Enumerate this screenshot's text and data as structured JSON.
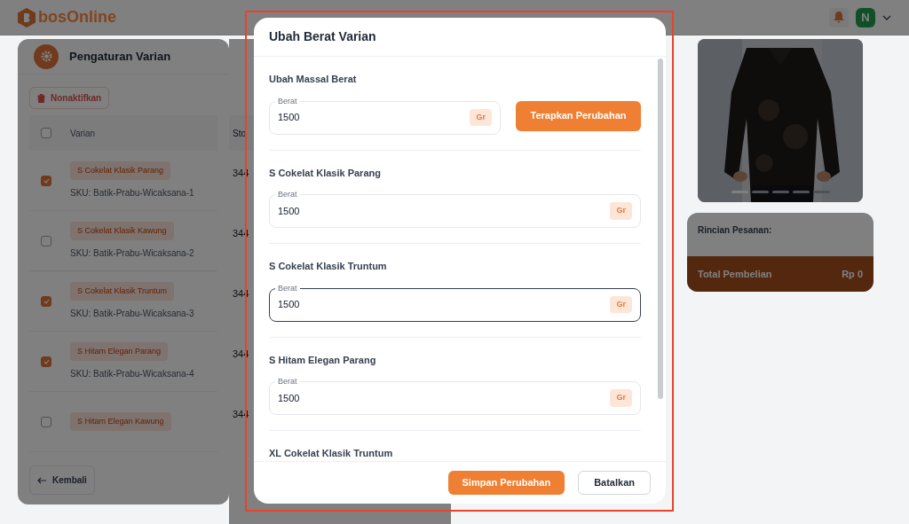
{
  "header": {
    "logo": "bosOnline",
    "avatar": "N"
  },
  "panel": {
    "title": "Pengaturan Varian",
    "deactivate_button": "Nonaktifkan",
    "select_all": {
      "checked": false
    },
    "columns": [
      "Varian",
      "Sto"
    ],
    "rows": [
      {
        "variant": "S Cokelat Klasik Parang",
        "sku": "SKU: Batik-Prabu-Wicaksana-1",
        "column_2": "344",
        "checked": true
      },
      {
        "variant": "S Cokelat Klasik Kawung",
        "sku": "SKU: Batik-Prabu-Wicaksana-2",
        "column_2": "344",
        "checked": false
      },
      {
        "variant": "S Cokelat Klasik Truntum",
        "sku": "SKU: Batik-Prabu-Wicaksana-3",
        "column_2": "344",
        "checked": true
      },
      {
        "variant": "S Hitam Elegan Parang",
        "sku": "SKU: Batik-Prabu-Wicaksana-4",
        "column_2": "344",
        "checked": true
      },
      {
        "variant": "S Hitam Elegan Kawung",
        "column_2": "344",
        "checked": false
      }
    ],
    "back_button": "Kembali"
  },
  "gallery": {
    "dots": [
      {
        "selected": true
      },
      {
        "selected": false
      },
      {
        "selected": false
      },
      {
        "selected": false
      },
      {
        "selected": false
      }
    ]
  },
  "summary": {
    "title": "Rincian Pesanan:",
    "total_label": "Total Pembelian",
    "total_value": "Rp 0"
  },
  "modal": {
    "title": "Ubah Berat Varian",
    "bulk": {
      "title": "Ubah Massal Berat",
      "field_label": "Berat",
      "value": "1500",
      "unit": "Gr",
      "apply_button": "Terapkan Perubahan"
    },
    "variants": [
      {
        "name": "S Cokelat Klasik Parang",
        "field_label": "Berat",
        "value": "1500",
        "unit": "Gr",
        "focused": false
      },
      {
        "name": "S Cokelat Klasik Truntum",
        "field_label": "Berat",
        "value": "1500",
        "unit": "Gr",
        "focused": true
      },
      {
        "name": "S Hitam Elegan Parang",
        "field_label": "Berat",
        "value": "1500",
        "unit": "Gr",
        "focused": false
      },
      {
        "name": "XL Cokelat Klasik Truntum"
      }
    ],
    "save_button": "Simpan Perubahan",
    "cancel_button": "Batalkan"
  }
}
